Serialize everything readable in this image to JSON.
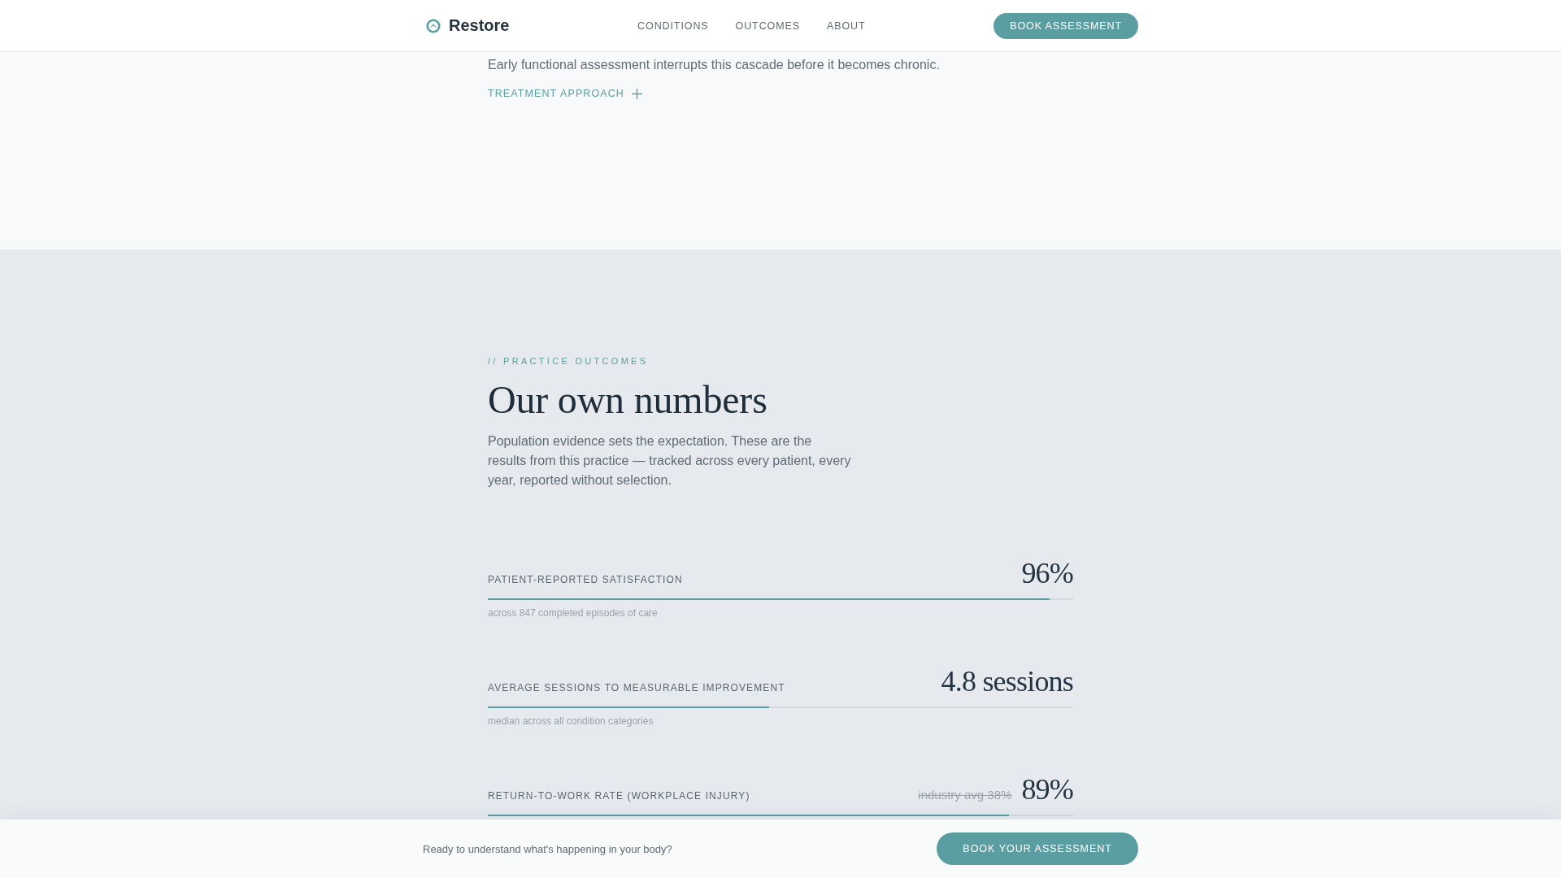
{
  "header": {
    "brand": "Restore",
    "nav": [
      {
        "label": "CONDITIONS"
      },
      {
        "label": "OUTCOMES"
      },
      {
        "label": "ABOUT"
      }
    ],
    "cta": "BOOK ASSESSMENT"
  },
  "intro": {
    "text": "Early functional assessment interrupts this cascade before it becomes chronic.",
    "toggle": {
      "label": "TREATMENT APPROACH",
      "expanded": false
    }
  },
  "outcomes": {
    "eyebrow": "// PRACTICE OUTCOMES",
    "title": "Our own numbers",
    "lead": "Population evidence sets the expectation. These are the results from this practice — tracked across every patient, every year, reported without selection.",
    "metrics": [
      {
        "label": "PATIENT-REPORTED SATISFACTION",
        "value": "96%",
        "level": 0.96,
        "note": "across 847 completed episodes of care"
      },
      {
        "label": "AVERAGE SESSIONS TO MEASURABLE IMPROVEMENT",
        "value": "4.8 sessions",
        "level": 0.48,
        "note": "median across all condition categories"
      },
      {
        "label": "RETURN-TO-WORK RATE (WORKPLACE INJURY)",
        "comparison": "industry avg 38%",
        "value": "89%",
        "level": 0.89
      }
    ]
  },
  "cta_bar": {
    "text": "Ready to understand what's happening in your body?",
    "button": "BOOK YOUR ASSESSMENT"
  }
}
